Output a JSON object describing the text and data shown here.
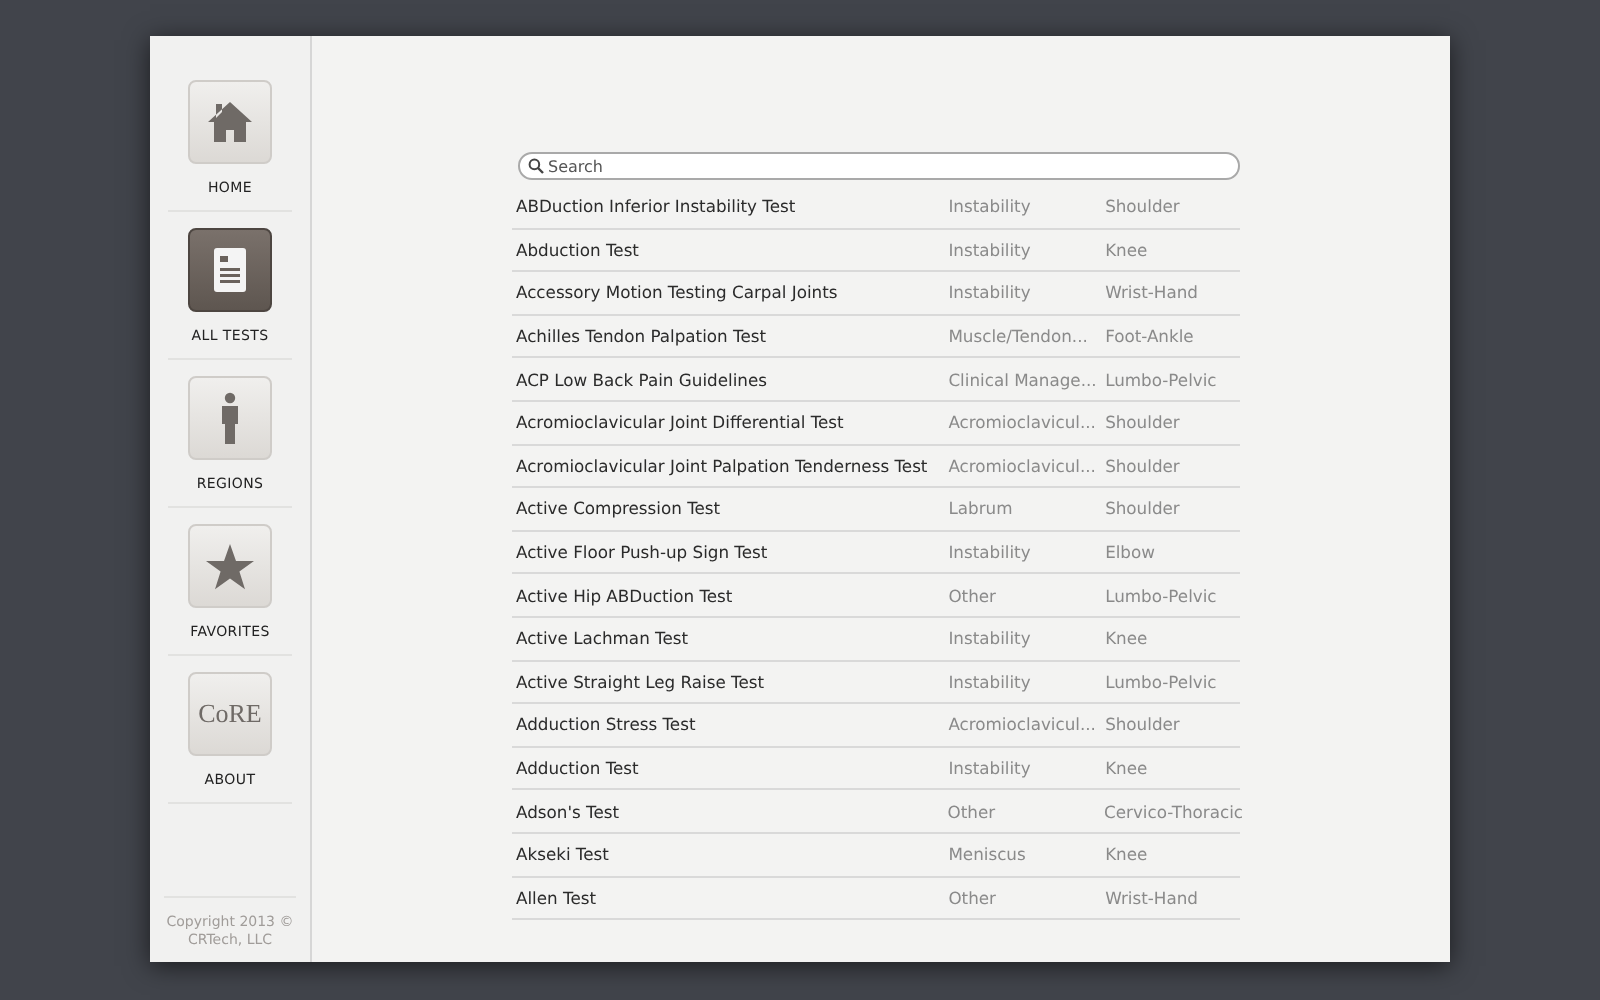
{
  "sidebar": {
    "items": [
      {
        "label": "HOME",
        "kind": "home",
        "selected": false
      },
      {
        "label": "ALL TESTS",
        "kind": "tests",
        "selected": true
      },
      {
        "label": "REGIONS",
        "kind": "regions",
        "selected": false
      },
      {
        "label": "FAVORITES",
        "kind": "favorites",
        "selected": false
      },
      {
        "label": "ABOUT",
        "kind": "about",
        "selected": false,
        "logo": "CoRE"
      }
    ],
    "copyright": "Copyright 2013 © CRTech, LLC"
  },
  "search": {
    "placeholder": "Search"
  },
  "table": {
    "rows": [
      {
        "name": "ABDuction Inferior Instability Test",
        "category": "Instability",
        "region": "Shoulder"
      },
      {
        "name": "Abduction Test",
        "category": "Instability",
        "region": "Knee"
      },
      {
        "name": "Accessory Motion Testing Carpal Joints",
        "category": "Instability",
        "region": "Wrist-Hand"
      },
      {
        "name": "Achilles Tendon Palpation Test",
        "category": "Muscle/Tendon...",
        "region": "Foot-Ankle"
      },
      {
        "name": "ACP Low Back Pain Guidelines",
        "category": "Clinical Manage...",
        "region": "Lumbo-Pelvic"
      },
      {
        "name": "Acromioclavicular Joint Differential Test",
        "category": "Acromioclavicul...",
        "region": "Shoulder"
      },
      {
        "name": "Acromioclavicular Joint Palpation Tenderness Test",
        "category": "Acromioclavicul...",
        "region": "Shoulder"
      },
      {
        "name": "Active Compression Test",
        "category": "Labrum",
        "region": "Shoulder"
      },
      {
        "name": "Active Floor Push-up Sign Test",
        "category": "Instability",
        "region": "Elbow"
      },
      {
        "name": "Active Hip ABDuction Test",
        "category": "Other",
        "region": "Lumbo-Pelvic"
      },
      {
        "name": "Active Lachman Test",
        "category": "Instability",
        "region": "Knee"
      },
      {
        "name": "Active Straight Leg Raise Test",
        "category": "Instability",
        "region": "Lumbo-Pelvic"
      },
      {
        "name": "Adduction Stress Test",
        "category": "Acromioclavicul...",
        "region": "Shoulder"
      },
      {
        "name": "Adduction Test",
        "category": "Instability",
        "region": "Knee"
      },
      {
        "name": "Adson's Test",
        "category": "Other",
        "region": "Cervico-Thoracic"
      },
      {
        "name": "Akseki Test",
        "category": "Meniscus",
        "region": "Knee"
      },
      {
        "name": "Allen Test",
        "category": "Other",
        "region": "Wrist-Hand"
      }
    ]
  }
}
